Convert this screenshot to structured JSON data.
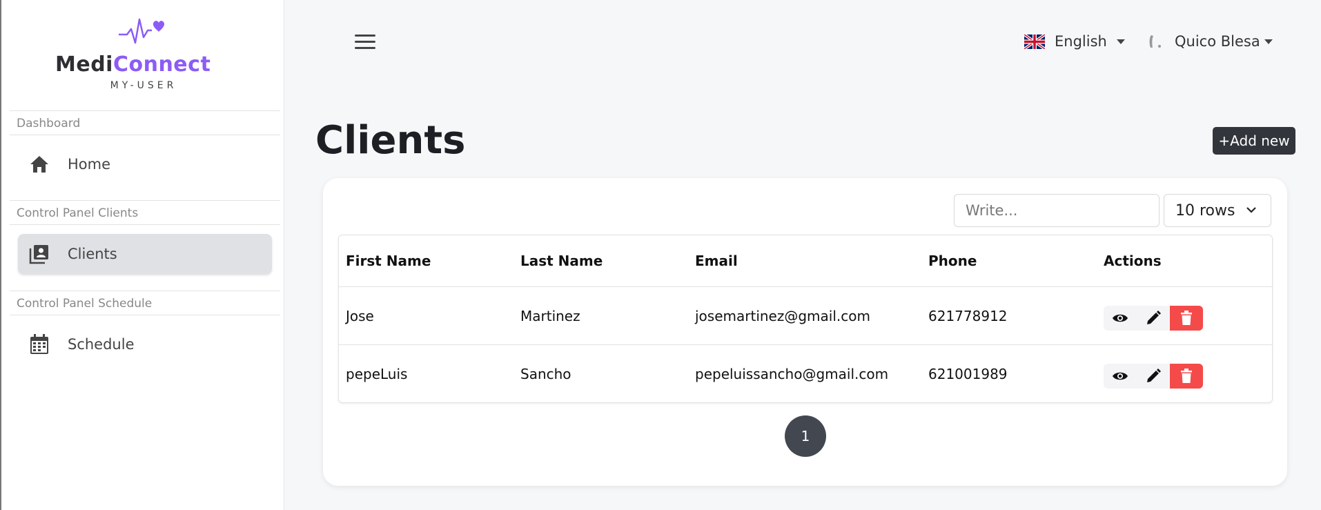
{
  "brand": {
    "name_part1": "Medi",
    "name_part2": "Connect",
    "subtitle": "MY-USER"
  },
  "sidebar": {
    "sections": [
      {
        "label": "Dashboard",
        "items": [
          {
            "label": "Home",
            "icon": "home-icon"
          }
        ]
      },
      {
        "label": "Control Panel Clients",
        "items": [
          {
            "label": "Clients",
            "icon": "clients-icon",
            "active": true
          }
        ]
      },
      {
        "label": "Control Panel Schedule",
        "items": [
          {
            "label": "Schedule",
            "icon": "calendar-icon"
          }
        ]
      }
    ]
  },
  "topbar": {
    "language": "English",
    "user": "Quico Blesa"
  },
  "main": {
    "title": "Clients",
    "add_button": "+Add new",
    "search_placeholder": "Write...",
    "rows_select": "10 rows",
    "table": {
      "headers": [
        "First Name",
        "Last Name",
        "Email",
        "Phone",
        "Actions"
      ],
      "rows": [
        {
          "first": "Jose",
          "last": "Martinez",
          "email": "josemartinez@gmail.com",
          "phone": "621778912"
        },
        {
          "first": "pepeLuis",
          "last": "Sancho",
          "email": "pepeluissancho@gmail.com",
          "phone": "621001989"
        }
      ]
    },
    "pagination": {
      "current": "1"
    }
  },
  "colors": {
    "accent": "#8b5cf6",
    "dark": "#32353b",
    "delete": "#f54a4a"
  }
}
